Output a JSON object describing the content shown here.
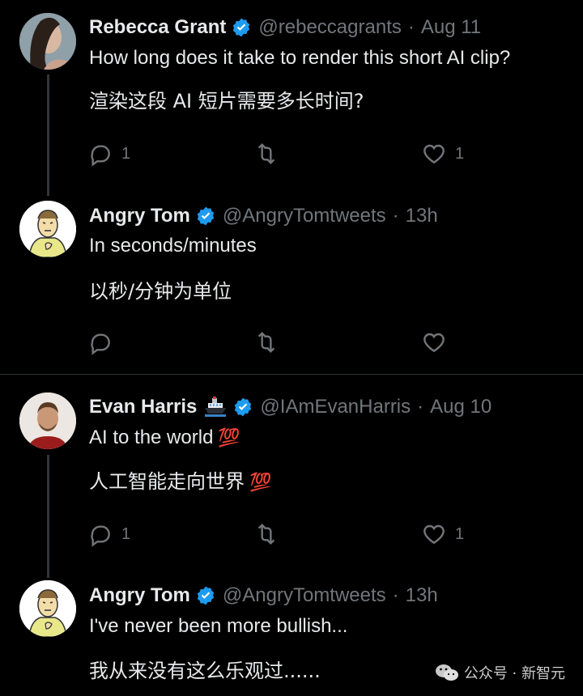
{
  "tweets": [
    {
      "name": "Rebecca Grant",
      "handle": "@rebeccagrants",
      "separator": "·",
      "time": "Aug 11",
      "line1": "How long does it take to render this short AI clip?",
      "line2": "渲染这段 AI 短片需要多长时间?",
      "reply_count": "1",
      "retweet_count": "",
      "like_count": "1"
    },
    {
      "name": "Angry Tom",
      "handle": "@AngryTomtweets",
      "separator": "·",
      "time": "13h",
      "line1": "In seconds/minutes",
      "line2": "以秒/分钟为单位",
      "reply_count": "",
      "retweet_count": "",
      "like_count": ""
    },
    {
      "name": "Evan Harris",
      "handle": "@IAmEvanHarris",
      "separator": "·",
      "time": "Aug 10",
      "line1": "AI to the world",
      "line2": "人工智能走向世界",
      "emoji": "💯",
      "reply_count": "1",
      "retweet_count": "",
      "like_count": "1"
    },
    {
      "name": "Angry Tom",
      "handle": "@AngryTomtweets",
      "separator": "·",
      "time": "13h",
      "line1": "I've never been more bullish...",
      "line2": "我从来没有这么乐观过......"
    }
  ],
  "watermark": "公众号 · 新智元",
  "colors": {
    "background": "#000000",
    "text": "#e7e9ea",
    "muted": "#71767b",
    "verified": "#1d9bf0",
    "hundred": "#f4212e"
  },
  "icons": [
    "reply-icon",
    "retweet-icon",
    "like-icon",
    "verified-badge-icon",
    "ship-icon",
    "wechat-icon"
  ]
}
